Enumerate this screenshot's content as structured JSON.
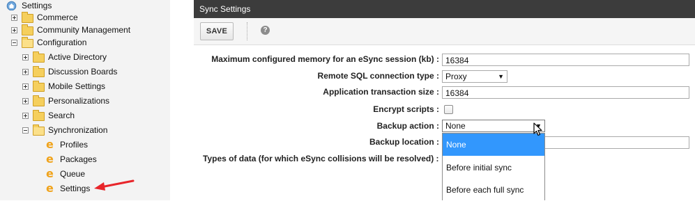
{
  "tree": {
    "root": "Settings",
    "items": [
      {
        "label": "Commerce",
        "state": "collapsed"
      },
      {
        "label": "Community Management",
        "state": "collapsed"
      },
      {
        "label": "Configuration",
        "state": "expanded"
      },
      {
        "label": "Active Directory",
        "state": "collapsed"
      },
      {
        "label": "Discussion Boards",
        "state": "collapsed"
      },
      {
        "label": "Mobile Settings",
        "state": "collapsed"
      },
      {
        "label": "Personalizations",
        "state": "collapsed"
      },
      {
        "label": "Search",
        "state": "collapsed"
      },
      {
        "label": "Synchronization",
        "state": "expanded"
      },
      {
        "label": "Profiles",
        "state": "leaf"
      },
      {
        "label": "Packages",
        "state": "leaf"
      },
      {
        "label": "Queue",
        "state": "leaf"
      },
      {
        "label": "Settings",
        "state": "leaf"
      }
    ]
  },
  "panel": {
    "title": "Sync Settings",
    "save_label": "SAVE",
    "help_icon": "help-icon"
  },
  "form": {
    "max_memory_label": "Maximum configured memory for an eSync session (kb) :",
    "max_memory_value": "16384",
    "remote_sql_label": "Remote SQL connection type :",
    "remote_sql_value": "Proxy",
    "transaction_size_label": "Application transaction size :",
    "transaction_size_value": "16384",
    "encrypt_label": "Encrypt scripts :",
    "encrypt_checked": false,
    "backup_action_label": "Backup action :",
    "backup_action_value": "None",
    "backup_location_label": "Backup location :",
    "backup_location_value": "",
    "types_label": "Types of data (for which eSync collisions will be resolved) :"
  },
  "dropdown": {
    "options": [
      "None",
      "Before initial sync",
      "Before each full sync"
    ],
    "selected": "None"
  },
  "colors": {
    "header_bg": "#3c3c3c",
    "highlight": "#3297fd",
    "arrow": "#e8252a",
    "folder": "#f5cf5d",
    "page_icon": "#f0a31b"
  }
}
